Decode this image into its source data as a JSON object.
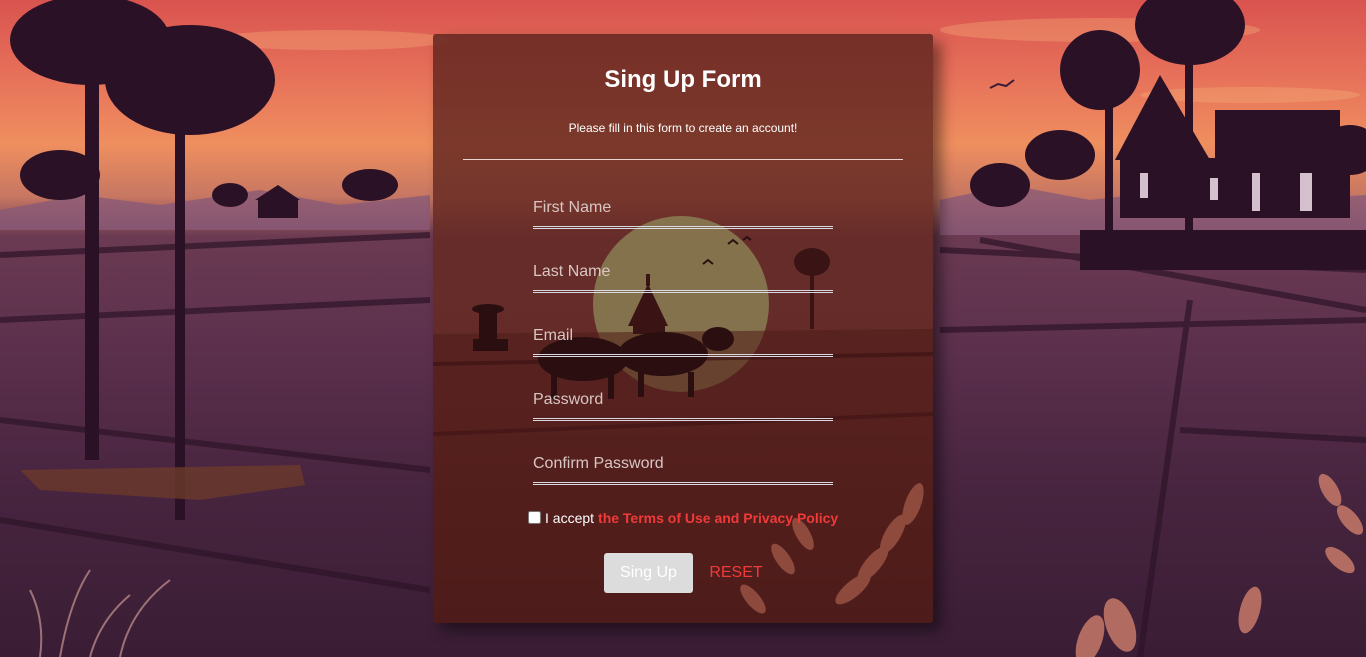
{
  "form": {
    "title": "Sing Up Form",
    "subtitle": "Please fill in this form to create an account!",
    "fields": {
      "first_name": {
        "placeholder": "First Name",
        "value": ""
      },
      "last_name": {
        "placeholder": "Last Name",
        "value": ""
      },
      "email": {
        "placeholder": "Email",
        "value": ""
      },
      "password": {
        "placeholder": "Password",
        "value": ""
      },
      "confirm_password": {
        "placeholder": "Confirm Password",
        "value": ""
      }
    },
    "terms": {
      "prefix": "I accept",
      "link": "the Terms of Use and Privacy Policy",
      "checked": false
    },
    "buttons": {
      "signup_label": "Sing Up",
      "reset_label": "RESET"
    }
  },
  "colors": {
    "accent_red": "#f03a3a",
    "card_overlay": "#581e1c",
    "signup_button_bg": "#dcdcdc"
  }
}
